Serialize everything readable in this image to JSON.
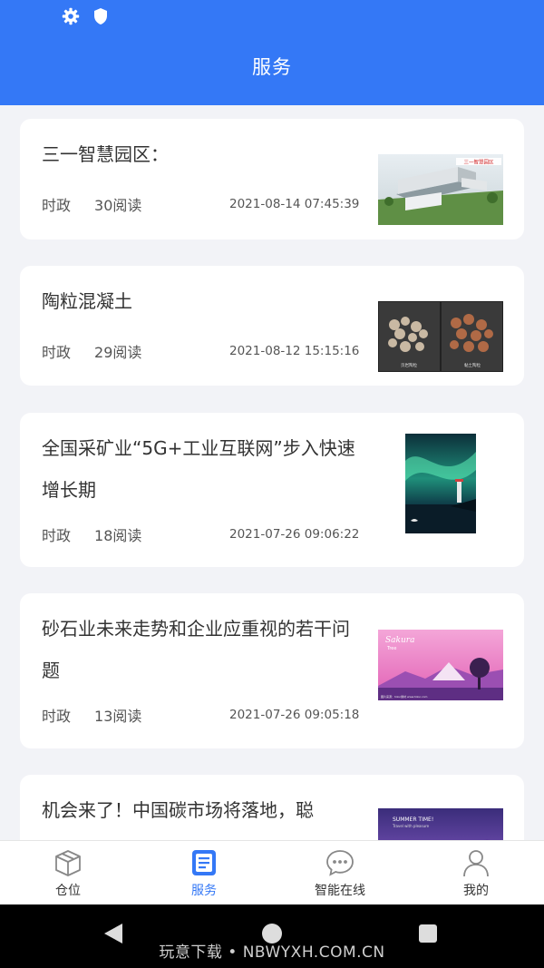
{
  "header": {
    "title": "服务"
  },
  "articles": [
    {
      "title": "三一智慧园区：",
      "category": "时政",
      "reads": "30阅读",
      "date": "2021-08-14 07:45:39"
    },
    {
      "title": "陶粒混凝土",
      "category": "时政",
      "reads": "29阅读",
      "date": "2021-08-12 15:15:16"
    },
    {
      "title": "全国采矿业“5G+工业互联网”步入快速增长期",
      "category": "时政",
      "reads": "18阅读",
      "date": "2021-07-26 09:06:22"
    },
    {
      "title": "砂石业未来走势和企业应重视的若干问题",
      "category": "时政",
      "reads": "13阅读",
      "date": "2021-07-26 09:05:18"
    },
    {
      "title": "机会来了！中国碳市场将落地，聪",
      "category": "",
      "reads": "",
      "date": ""
    }
  ],
  "thumbnails": {
    "park_banner": "三一智慧园区",
    "ceramsite_left": "页岩陶粒",
    "ceramsite_right": "黏土陶粒",
    "sakura_script": "Sakura",
    "sakura_sub": "Tree",
    "sakura_footer": "图片来源：hizui素材 www.hizui.com",
    "summer_title": "SUMMER TIME!",
    "summer_sub": "Travel with pleasure"
  },
  "tabs": [
    {
      "label": "仓位",
      "icon": "box-icon"
    },
    {
      "label": "服务",
      "icon": "document-icon"
    },
    {
      "label": "智能在线",
      "icon": "chat-bubble-icon"
    },
    {
      "label": "我的",
      "icon": "person-icon"
    }
  ],
  "active_tab": "服务",
  "watermark": "玩意下载 • NBWYXH.COM.CN",
  "colors": {
    "accent": "#3478f6",
    "background": "#f2f3f7"
  }
}
